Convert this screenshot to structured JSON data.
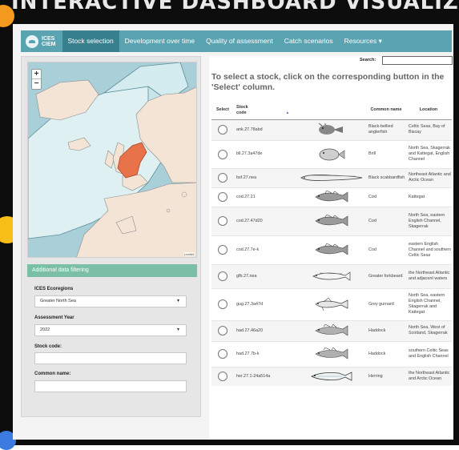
{
  "banner": {
    "title": "INTERACTIVE DASHBOARD VISUALIZATION"
  },
  "navbar": {
    "logo_line1": "ICES",
    "logo_line2": "CIEM",
    "items": [
      {
        "label": "Stock selection"
      },
      {
        "label": "Development over time"
      },
      {
        "label": "Quality of assessment"
      },
      {
        "label": "Catch scenarios"
      },
      {
        "label": "Resources ▾"
      }
    ]
  },
  "map": {
    "zoom_in": "+",
    "zoom_out": "−",
    "attribution": "Leaflet"
  },
  "filters": {
    "header": "Additional data filtering",
    "ecoregion_label": "ICES Ecoregions",
    "ecoregion_value": "Greater North Sea",
    "year_label": "Assessment Year",
    "year_value": "2022",
    "stock_code_label": "Stock code:",
    "common_name_label": "Common name:"
  },
  "search": {
    "label": "Search:"
  },
  "instructions": "To select a stock, click on the corresponding button in the 'Select' column.",
  "table": {
    "columns": [
      "Select",
      "Stock code",
      "▴",
      "Common name",
      "Location"
    ],
    "rows": [
      {
        "code": "ank.27.78abd",
        "common": "Black-bellied anglerfish",
        "location": "Celtic Seas, Bay of Biscay",
        "fish": "anglerfish"
      },
      {
        "code": "bll.27.3a47de",
        "common": "Brill",
        "location": "North Sea, Skagerrak and Kattegat, English Channel",
        "fish": "flatfish"
      },
      {
        "code": "bsf.27.nea",
        "common": "Black scabbardfish",
        "location": "Northeast Atlantic and Arctic Ocean",
        "fish": "eel"
      },
      {
        "code": "cod.27.21",
        "common": "Cod",
        "location": "Kattegat",
        "fish": "cod"
      },
      {
        "code": "cod.27.47d20",
        "common": "Cod",
        "location": "North Sea, eastern English Channel, Skagerrak",
        "fish": "cod"
      },
      {
        "code": "cod.27.7e-k",
        "common": "Cod",
        "location": "eastern English Channel and southern Celtic Seas",
        "fish": "cod"
      },
      {
        "code": "gfb.27.nea",
        "common": "Greater forkbeard",
        "location": "the Northeast Atlantic and adjacent waters",
        "fish": "forkbeard"
      },
      {
        "code": "gug.27.3a47d",
        "common": "Grey gurnard",
        "location": "North Sea, eastern English Channel, Skagerrak and Kattegat",
        "fish": "gurnard"
      },
      {
        "code": "had.27.46a20",
        "common": "Haddock",
        "location": "North Sea, West of Scotland, Skagerrak",
        "fish": "haddock"
      },
      {
        "code": "had.27.7b-k",
        "common": "Haddock",
        "location": "southern Celtic Seas and English Channel",
        "fish": "haddock"
      },
      {
        "code": "her.27.1-24a514a",
        "common": "Herring",
        "location": "the Northeast Atlantic and Arctic Ocean",
        "fish": "herring"
      }
    ]
  },
  "colors": {
    "navbar": "#5aa3b0",
    "nav_active": "#37808e",
    "filter_header": "#7bbfa6",
    "map_sea": "#a9cfd8",
    "map_land": "#f4e4d6",
    "map_selected": "#e8734a"
  }
}
